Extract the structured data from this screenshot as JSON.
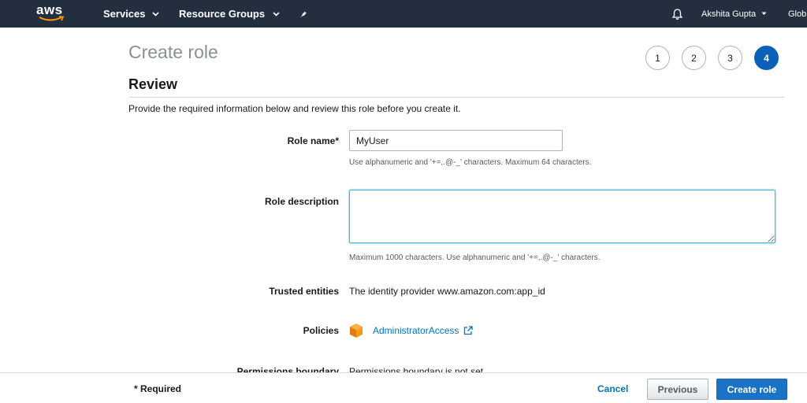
{
  "nav": {
    "logo_text": "aws",
    "services_label": "Services",
    "resource_groups_label": "Resource Groups",
    "user_name": "Akshita Gupta",
    "region_label": "Glob"
  },
  "header": {
    "title": "Create role",
    "steps": [
      "1",
      "2",
      "3",
      "4"
    ],
    "active_step": "4"
  },
  "review": {
    "section_title": "Review",
    "intro": "Provide the required information below and review this role before you create it."
  },
  "form": {
    "role_name_label": "Role name*",
    "role_name_value": "MyUser",
    "role_name_hint": "Use alphanumeric and '+=,.@-_' characters. Maximum 64 characters.",
    "role_description_label": "Role description",
    "role_description_value": "",
    "role_description_hint": "Maximum 1000 characters. Use alphanumeric and '+=,.@-_' characters.",
    "trusted_entities_label": "Trusted entities",
    "trusted_entities_value": "The identity provider www.amazon.com:app_id",
    "policies_label": "Policies",
    "policy_name": "AdministratorAccess",
    "permissions_boundary_label": "Permissions boundary",
    "permissions_boundary_value": "Permissions boundary is not set"
  },
  "footer": {
    "required_text": "* Required",
    "cancel_label": "Cancel",
    "previous_label": "Previous",
    "create_label": "Create role"
  },
  "colors": {
    "nav_bg": "#232f3e",
    "primary_button": "#1a73c4",
    "link": "#0073bb",
    "aws_orange": "#ff9900"
  },
  "icons": [
    "aws-logo",
    "caret-down-icon",
    "pin-icon",
    "bell-icon",
    "policy-box-icon",
    "external-link-icon"
  ]
}
